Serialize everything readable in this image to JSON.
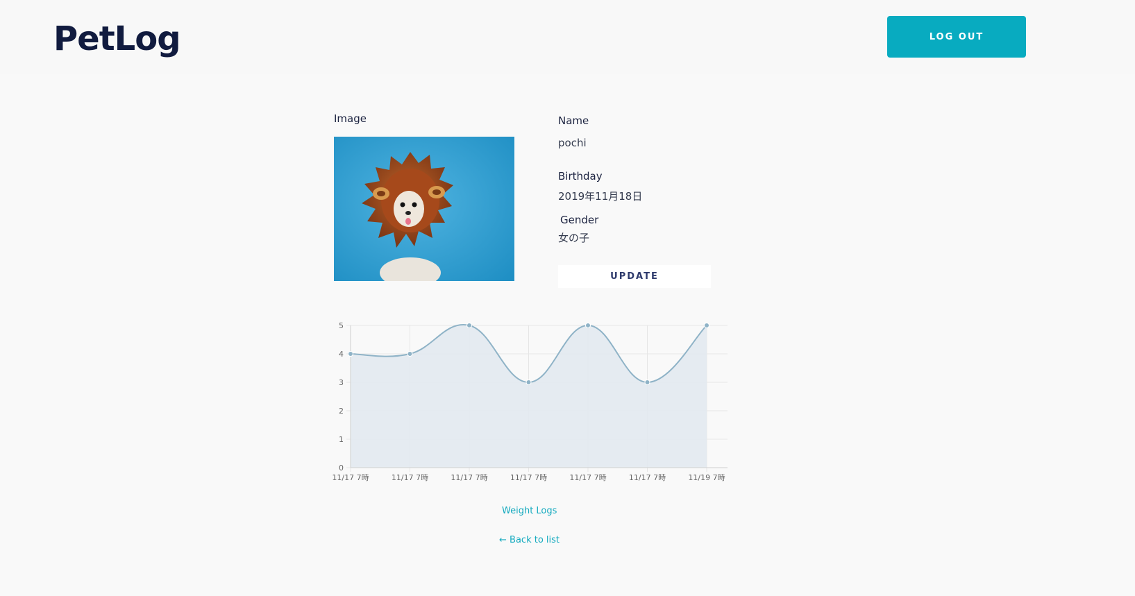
{
  "header": {
    "logo": "PetLog",
    "logout_label": "LOG OUT"
  },
  "pet": {
    "image_label": "Image",
    "name_label": "Name",
    "name": "pochi",
    "birthday_label": "Birthday",
    "birthday": "2019年11月18日",
    "gender_label": "Gender",
    "gender": "女の子",
    "update_label": "UPDATE"
  },
  "chart_data": {
    "type": "line",
    "categories": [
      "11/17 7時",
      "11/17 7時",
      "11/17 7時",
      "11/17 7時",
      "11/17 7時",
      "11/17 7時",
      "11/19 7時"
    ],
    "values": [
      4,
      4,
      5,
      3,
      5,
      3,
      5
    ],
    "ylim": [
      0,
      5
    ],
    "yticks": [
      "0",
      "1",
      "2",
      "3",
      "4",
      "5"
    ],
    "fill": true,
    "grid": true,
    "colors": {
      "line": "#8fb3c7",
      "fill": "#e2e9ef",
      "grid": "#e6e6e6",
      "tick": "#666666"
    }
  },
  "links": {
    "weight_logs": "Weight Logs",
    "back_arrow": "←",
    "back": "Back to list"
  },
  "colors": {
    "accent": "#08abc0",
    "brand": "#111b3f"
  }
}
